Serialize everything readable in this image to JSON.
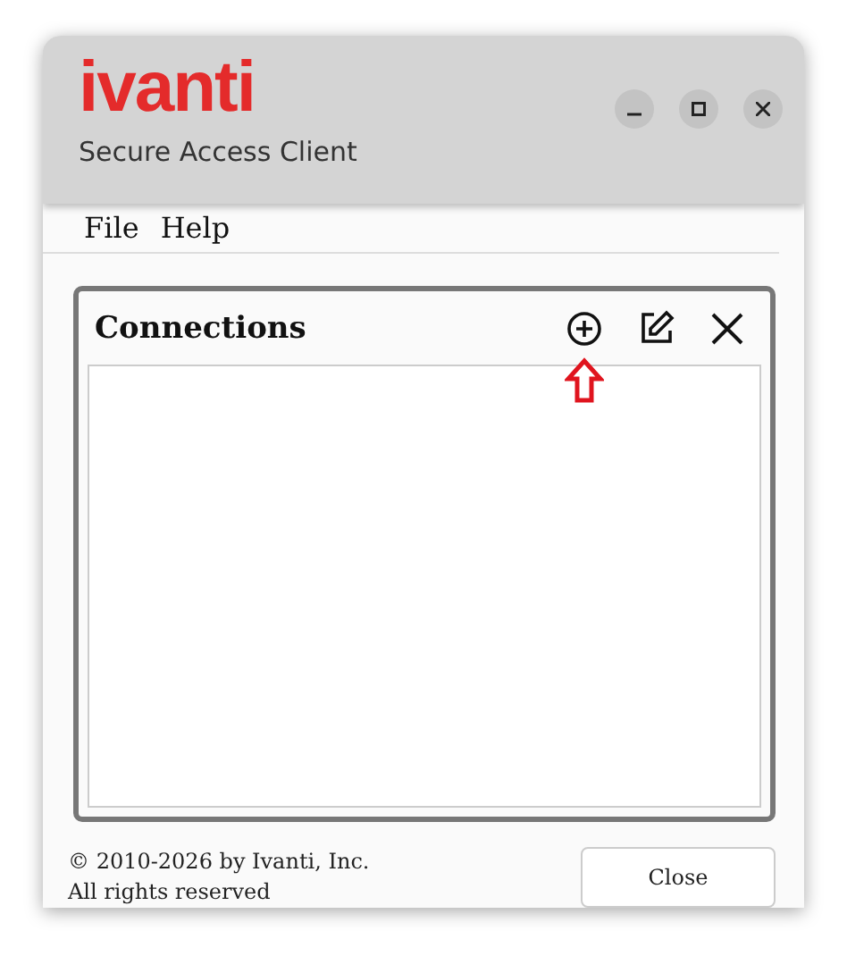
{
  "window": {
    "logo": "ivanti",
    "subtitle": "Secure Access Client",
    "controls": [
      {
        "kind": "minimize"
      },
      {
        "kind": "maximize"
      },
      {
        "kind": "close"
      }
    ]
  },
  "menu": [
    "File",
    "Help"
  ],
  "connections": {
    "title": "Connections",
    "actions": [
      {
        "kind": "add",
        "highlighted": true
      },
      {
        "kind": "edit",
        "highlighted": false
      },
      {
        "kind": "delete",
        "highlighted": false
      }
    ]
  },
  "footer": {
    "copyright": "© 2010-2026 by Ivanti, Inc.",
    "rights": "All rights reserved",
    "button": "Close"
  }
}
